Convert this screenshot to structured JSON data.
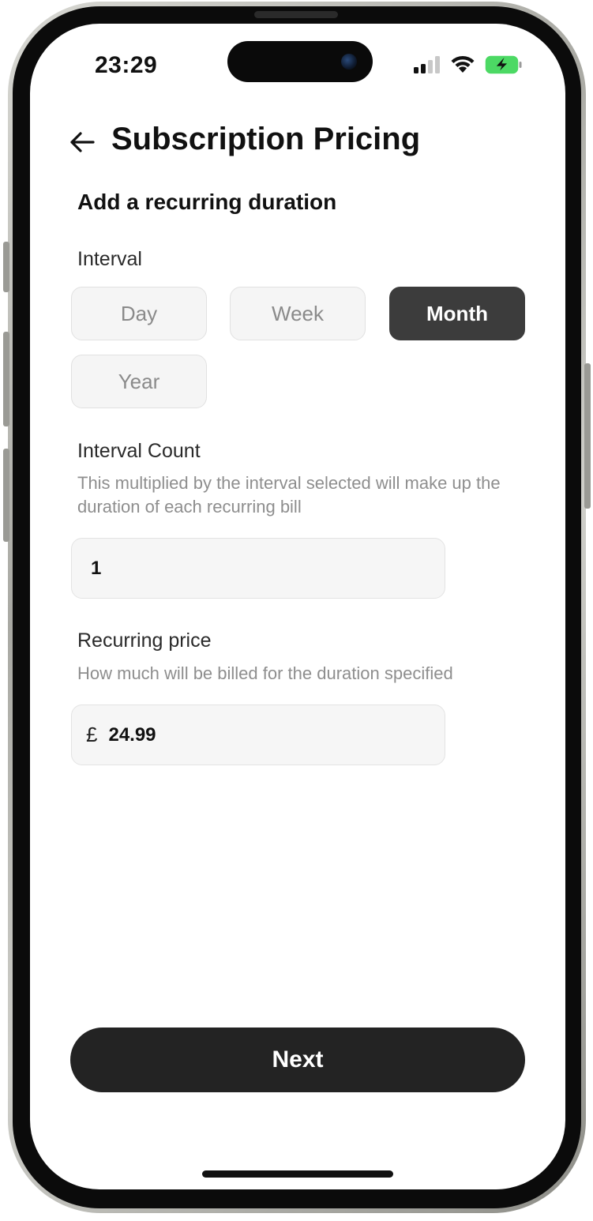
{
  "status_bar": {
    "time": "23:29",
    "icons": [
      "cellular-signal-icon",
      "wifi-icon",
      "battery-charging-icon"
    ],
    "battery_color": "#4cd964"
  },
  "header": {
    "back_icon": "arrow-left-icon",
    "title": "Subscription Pricing"
  },
  "form": {
    "section_title": "Add a recurring duration",
    "interval": {
      "label": "Interval",
      "options": [
        "Day",
        "Week",
        "Month",
        "Year"
      ],
      "selected": "Month"
    },
    "interval_count": {
      "label": "Interval Count",
      "helper": "This multiplied by the interval selected will make up the duration of each recurring bill",
      "value": "1"
    },
    "recurring_price": {
      "label": "Recurring price",
      "helper": "How much will be billed for the duration specified",
      "currency": "£",
      "value": "24.99"
    }
  },
  "footer": {
    "next_label": "Next"
  },
  "colors": {
    "accent_dark": "#232323",
    "chip_active": "#3c3c3c",
    "chip_inactive_bg": "#f5f5f5",
    "muted_text": "#8e8e8e"
  }
}
